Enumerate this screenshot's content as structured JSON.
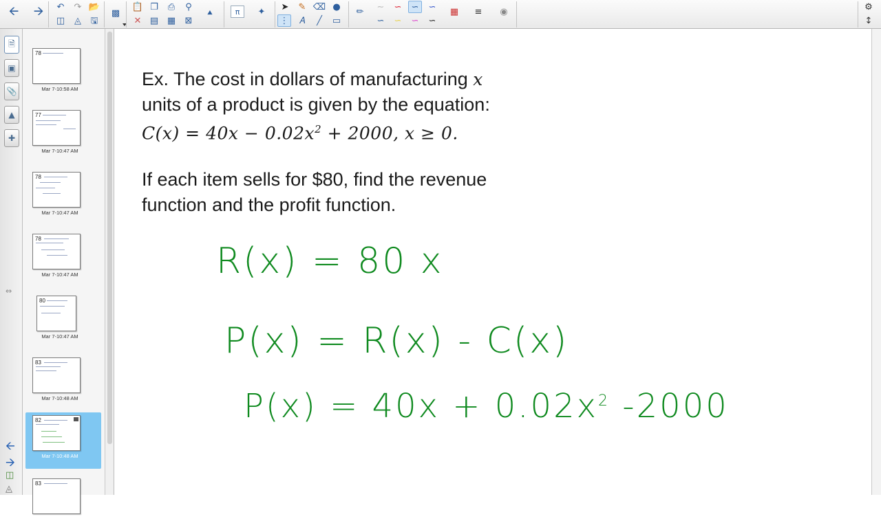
{
  "toolbar": {
    "icons": [
      "back-arrow",
      "forward-arrow",
      "undo",
      "redo",
      "add-page",
      "save",
      "screen-shade",
      "paste",
      "delete",
      "table",
      "capture",
      "properties",
      "math",
      "extension",
      "select",
      "pen",
      "eraser",
      "fill",
      "line",
      "shapes",
      "creative-pen",
      "color-palette",
      "lines",
      "magic-pen",
      "settings",
      "move-toolbar"
    ]
  },
  "slides": [
    {
      "label": "78",
      "time": "Mar 7-10:58 AM"
    },
    {
      "label": "77",
      "time": "Mar 7-10:47 AM"
    },
    {
      "label": "78",
      "time": "Mar 7-10:47 AM"
    },
    {
      "label": "78",
      "time": "Mar 7-10:47 AM"
    },
    {
      "label": "80",
      "time": "Mar 7-10:47 AM"
    },
    {
      "label": "83",
      "time": "Mar 7-10:48 AM"
    },
    {
      "label": "82",
      "time": "Mar 7-10:48 AM"
    },
    {
      "label": "83",
      "time": ""
    }
  ],
  "problem": {
    "line1_text": "Ex. The cost in dollars of manufacturing ",
    "line1_var": "x",
    "line2": "units of a product is given by the equation:",
    "equation_lhs": "C(x) = 40x − 0.02x",
    "equation_exp": "2",
    "equation_rhs": " + 2000,  x ≥ 0.",
    "line4": "If each item sells for $80, find the revenue",
    "line5": "function and the profit function."
  },
  "handwriting": {
    "revenue": "R(x) = 80 x",
    "profit_def": "P(x) = R(x) - C(x)",
    "profit_lhs": "P(x) = 40x + 0.02x",
    "profit_exp": "2",
    "profit_rhs": " -2000"
  },
  "colors": {
    "ink": "#0f8a1f",
    "selected_thumb": "#7fc7f2",
    "toolbar_icon": "#2e5f9e"
  }
}
